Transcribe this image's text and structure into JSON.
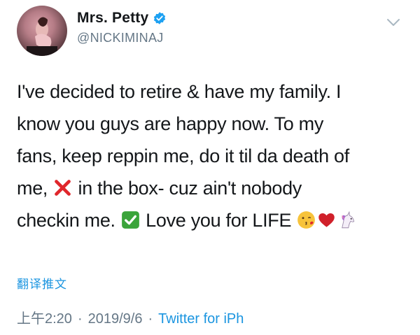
{
  "user": {
    "display_name": "Mrs. Petty",
    "handle": "@NICKIMINAJ",
    "verified": true
  },
  "tweet": {
    "line1": "I've decided to retire & have my family. I",
    "line2": "know you guys are happy now. To my",
    "line3": "fans, keep reppin me, do it til da death of",
    "line4a": "me,",
    "line4b": "in the box- cuz ain't nobody",
    "line5a": "checkin me.",
    "line5b": "Love you for LIFE",
    "emojis": [
      "cross-mark-icon",
      "check-mark-button-icon",
      "kissing-face-icon",
      "red-heart-icon",
      "unicorn-icon"
    ]
  },
  "translate_label": "翻译推文",
  "meta": {
    "time": "上午2:20",
    "date": "2019/9/6",
    "source": "Twitter for iPh",
    "separator": "·"
  },
  "colors": {
    "link": "#1b95e0",
    "muted": "#657786",
    "text": "#14171a",
    "verified": "#1da1f2"
  }
}
